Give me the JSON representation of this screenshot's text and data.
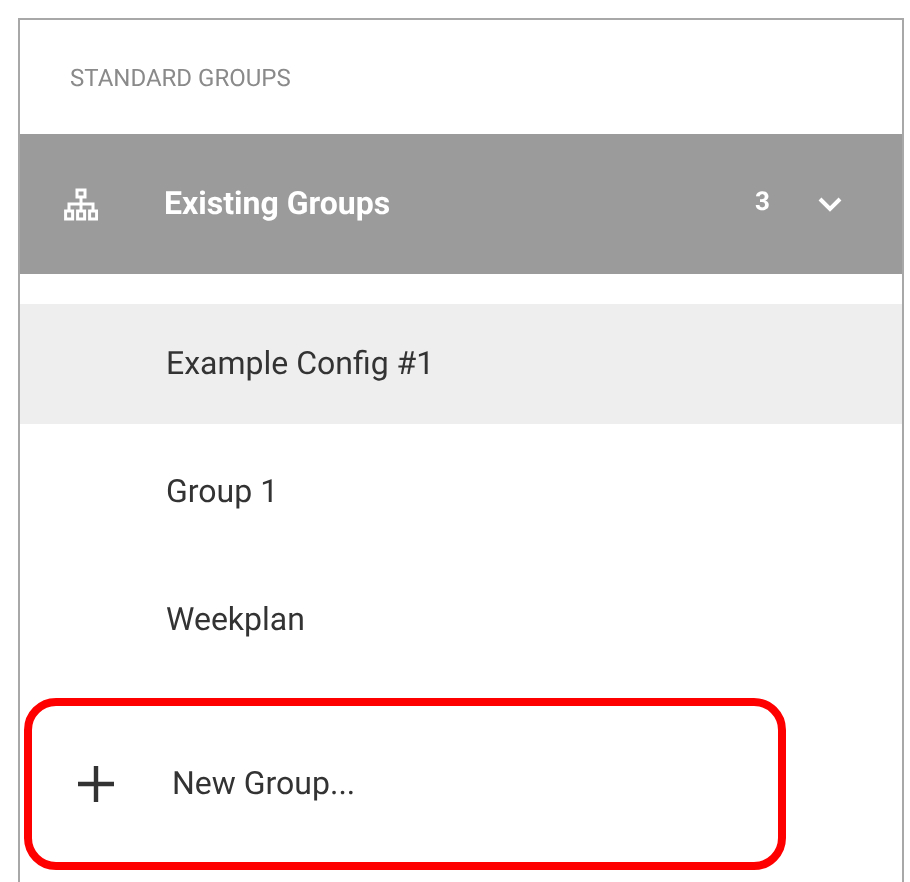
{
  "section_heading": "STANDARD GROUPS",
  "group_header": {
    "title": "Existing Groups",
    "count": "3",
    "expanded": true
  },
  "items": [
    {
      "label": "Example Config #1",
      "selected": true
    },
    {
      "label": "Group 1",
      "selected": false
    },
    {
      "label": "Weekplan",
      "selected": false
    }
  ],
  "new_group": {
    "label": "New Group...",
    "highlighted": true
  }
}
